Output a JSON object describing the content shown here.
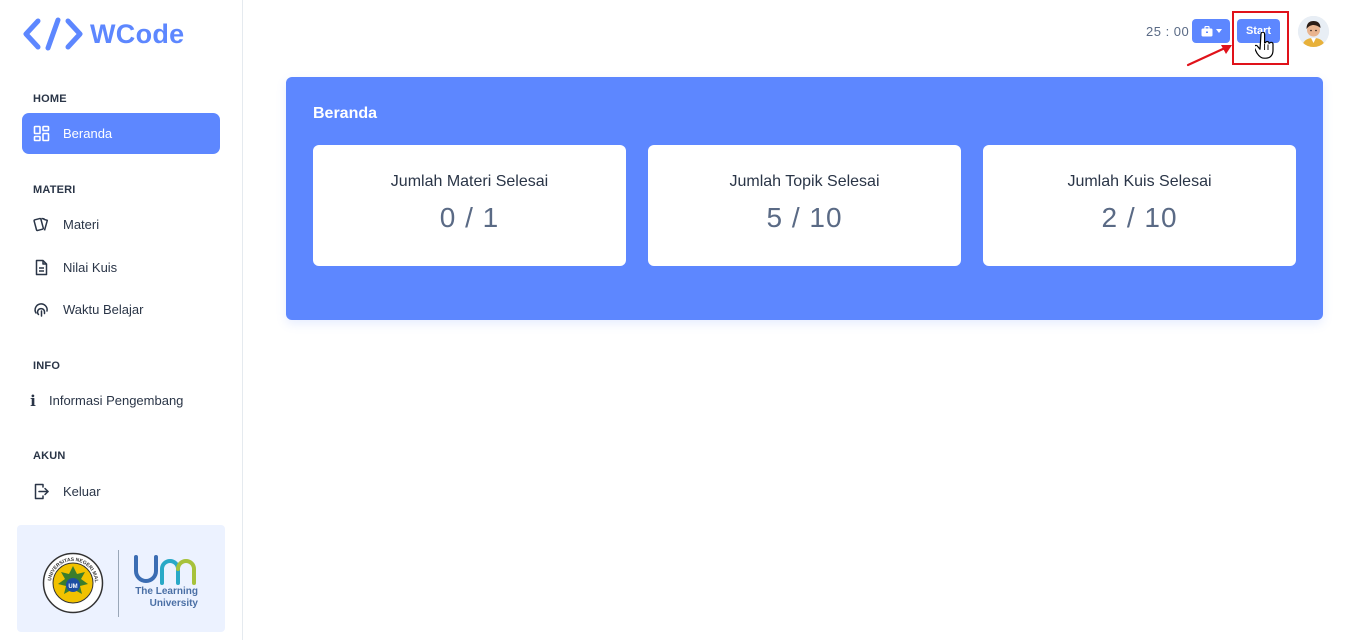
{
  "app": {
    "name": "WCode"
  },
  "sidebar": {
    "sections": [
      {
        "title": "HOME",
        "items": [
          {
            "label": "Beranda",
            "icon": "dashboard-icon",
            "active": true
          }
        ]
      },
      {
        "title": "MATERI",
        "items": [
          {
            "label": "Materi",
            "icon": "cards-icon"
          },
          {
            "label": "Nilai Kuis",
            "icon": "file-text-icon"
          },
          {
            "label": "Waktu Belajar",
            "icon": "fingerprint-icon"
          }
        ]
      },
      {
        "title": "INFO",
        "items": [
          {
            "label": "Informasi Pengembang",
            "icon": "info-icon"
          }
        ]
      },
      {
        "title": "AKUN",
        "items": [
          {
            "label": "Keluar",
            "icon": "logout-icon"
          }
        ]
      }
    ],
    "university": {
      "seal_text": "UNIVERSITAS NEGERI MALANG",
      "seal_center": "UM",
      "tagline_line1": "The Learning",
      "tagline_line2": "University"
    }
  },
  "header": {
    "timer": "25 : 00",
    "tool_icon": "briefcase-icon",
    "start_label": "Start"
  },
  "main": {
    "title": "Beranda",
    "stats": [
      {
        "label": "Jumlah Materi Selesai",
        "value": "0 / 1"
      },
      {
        "label": "Jumlah Topik Selesai",
        "value": "5 / 10"
      },
      {
        "label": "Jumlah Kuis Selesai",
        "value": "2 / 10"
      }
    ]
  },
  "colors": {
    "primary": "#5d87ff",
    "highlight": "#e0121a",
    "light_bg": "#ecf2ff",
    "text": "#2a3547"
  }
}
